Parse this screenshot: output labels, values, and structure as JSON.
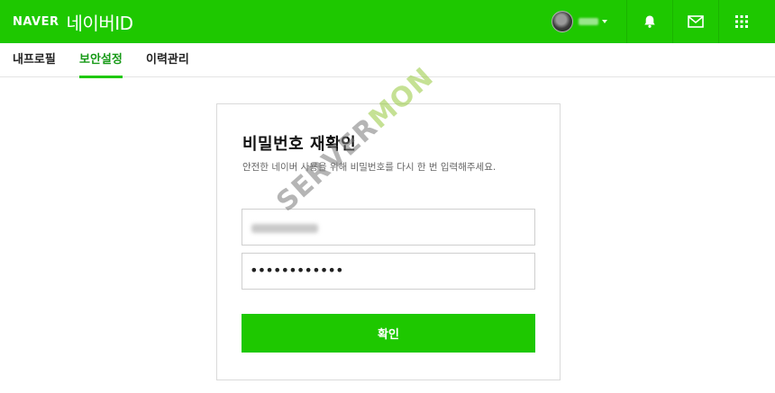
{
  "header": {
    "logo_text": "NAVER",
    "service_title": "네이버ID",
    "account": {
      "avatar_icon": "user-avatar",
      "menu_icon": "chevron-down-icon"
    },
    "buttons": [
      {
        "name": "notifications",
        "icon": "bell-icon"
      },
      {
        "name": "mail",
        "icon": "mail-icon"
      },
      {
        "name": "apps",
        "icon": "grid-icon"
      }
    ]
  },
  "tabs": [
    {
      "label": "내프로필",
      "active": false
    },
    {
      "label": "보안설정",
      "active": true
    },
    {
      "label": "이력관리",
      "active": false
    }
  ],
  "card": {
    "title": "비밀번호 재확인",
    "description": "안전한 네이버 사용을 위해 비밀번호를 다시 한 번 입력해주세요.",
    "password_value": "••••••••••••",
    "submit_label": "확인"
  },
  "watermark": {
    "part1": "SERVER",
    "part2": "MON"
  },
  "colors": {
    "brand_green": "#1ec800",
    "active_tab_text": "#179a17"
  }
}
